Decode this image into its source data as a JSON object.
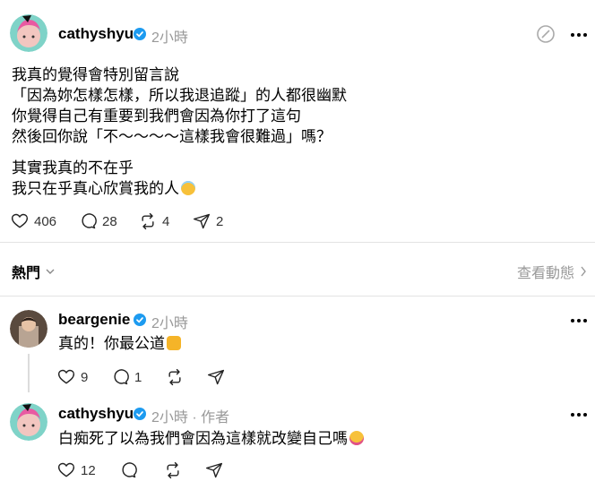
{
  "post": {
    "username": "cathyshyu",
    "time": "2小時",
    "lines": [
      "我真的覺得會特別留言說",
      "「因為妳怎樣怎樣，所以我退追蹤」的人都很幽默",
      "你覺得自己有重要到我們會因為你打了這句",
      "然後回你說「不～～～～這樣我會很難過」嗎？"
    ],
    "lines2": [
      "其實我真的不在乎",
      "我只在乎真心欣賞我的人"
    ],
    "likes": "406",
    "comments": "28",
    "reposts": "4",
    "shares": "2"
  },
  "sort": {
    "label": "熱門",
    "view_activity": "查看動態"
  },
  "reply1": {
    "username": "beargenie",
    "time": "2小時",
    "text": "真的！你最公道",
    "likes": "9",
    "comments": "1"
  },
  "reply2": {
    "username": "cathyshyu",
    "time": "2小時",
    "author_tag": "· 作者",
    "text": "白痴死了以為我們會因為這樣就改變自己嗎",
    "likes": "12"
  },
  "colors": {
    "verified": "#1d9bf0",
    "muted": "#999999"
  },
  "icons": [
    "heart-icon",
    "comment-icon",
    "repost-icon",
    "share-icon",
    "verified-icon",
    "more-icon",
    "chevron-down-icon",
    "chevron-right-icon",
    "ai-tag-icon"
  ]
}
